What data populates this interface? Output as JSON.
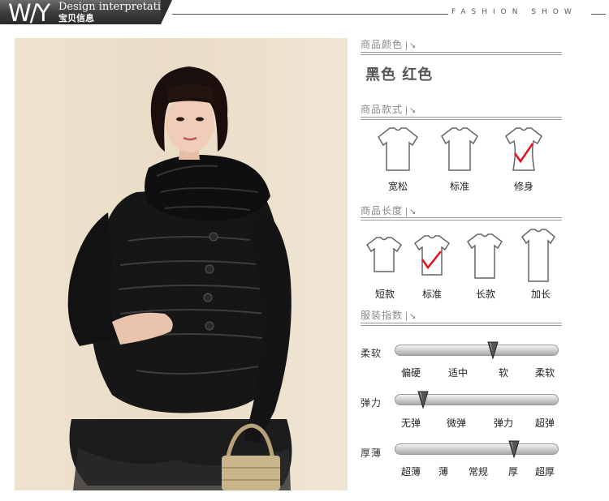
{
  "header": {
    "brand": "W/Y",
    "design_en": "Design interpretation",
    "design_cn": "宝贝信息",
    "fashion_show": "FASHION SHOW"
  },
  "color_section": {
    "title": "商品颜色",
    "arrow": "↘",
    "colors": "黑色 红色"
  },
  "style_section": {
    "title": "商品款式",
    "arrow": "↘",
    "items": [
      {
        "label": "宽松",
        "checked": false
      },
      {
        "label": "标准",
        "checked": false
      },
      {
        "label": "修身",
        "checked": true
      }
    ]
  },
  "length_section": {
    "title": "商品长度",
    "arrow": "↘",
    "items": [
      {
        "label": "短款",
        "checked": false
      },
      {
        "label": "标准",
        "checked": true
      },
      {
        "label": "长款",
        "checked": false
      },
      {
        "label": "加长",
        "checked": false
      }
    ]
  },
  "index_section": {
    "title": "服装指数",
    "arrow": "↘",
    "rows": [
      {
        "label": "柔软",
        "ticks": [
          "偏硬",
          "适中",
          "软",
          "柔软"
        ],
        "level": 0.6
      },
      {
        "label": "弹力",
        "ticks": [
          "无弹",
          "微弹",
          "弹力",
          "超弹"
        ],
        "level": 0.17
      },
      {
        "label": "厚薄",
        "ticks": [
          "超薄",
          "薄",
          "常规",
          "厚",
          "超厚"
        ],
        "level": 0.73
      }
    ]
  },
  "colors": {
    "check": "#e0141e",
    "header_dark": "#3a3a3a",
    "marker": "#555555"
  }
}
